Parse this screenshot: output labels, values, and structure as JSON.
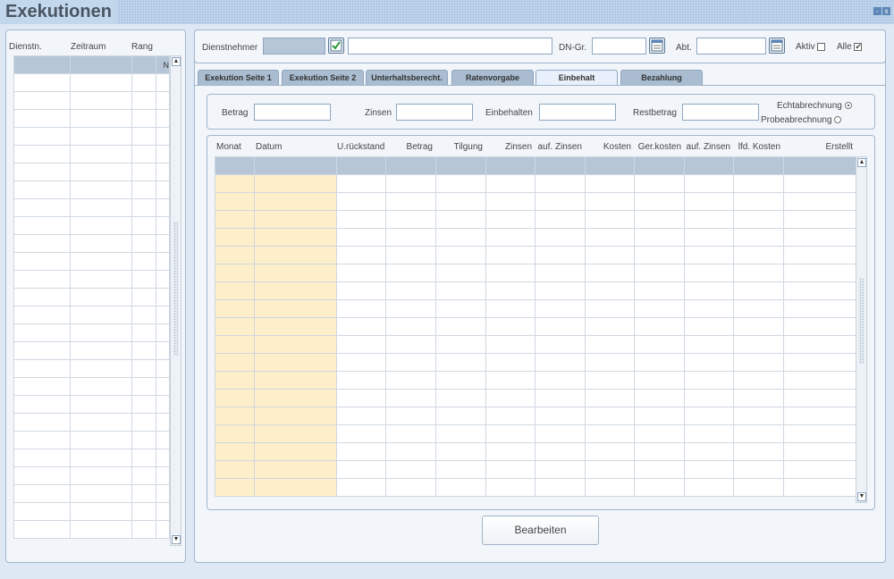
{
  "window": {
    "title": "Exekutionen",
    "minimize": "-",
    "close": "x"
  },
  "left_list": {
    "columns": [
      "Dienstn.",
      "Zeitraum",
      "Rang"
    ],
    "header_cell": "N",
    "rows": 27
  },
  "filter": {
    "dienstnehmer_label": "Dienstnehmer",
    "dienstnehmer_code": "",
    "dienstnehmer_name": "",
    "dn_gr_label": "DN-Gr.",
    "dn_gr_value": "",
    "abt_label": "Abt.",
    "abt_value": "",
    "aktiv_label": "Aktiv",
    "aktiv_checked": false,
    "alle_label": "Alle",
    "alle_checked": true
  },
  "tabs": [
    {
      "label": "Exekution Seite 1",
      "active": false
    },
    {
      "label": "Exekution Seite 2",
      "active": false
    },
    {
      "label": "Unterhaltsberecht.",
      "active": false
    },
    {
      "label": "Ratenvorgabe",
      "active": false
    },
    {
      "label": "Einbehalt",
      "active": true
    },
    {
      "label": "Bezahlung",
      "active": false
    }
  ],
  "summary": {
    "betrag_label": "Betrag",
    "betrag_value": "",
    "zinsen_label": "Zinsen",
    "zinsen_value": "",
    "einbehalten_label": "Einbehalten",
    "einbehalten_value": "",
    "restbetrag_label": "Restbetrag",
    "restbetrag_value": "",
    "echt_label": "Echtabrechnung",
    "probe_label": "Probeabrechnung",
    "selected_mode": "Echtabrechnung"
  },
  "einbehalt_table": {
    "columns": [
      "Monat",
      "Datum",
      "U.rückstand",
      "Betrag",
      "Tilgung",
      "Zinsen",
      "auf. Zinsen",
      "Kosten",
      "Ger.kosten",
      "auf. Zinsen",
      "lfd. Kosten",
      "Erstellt"
    ],
    "rows": 19
  },
  "actions": {
    "bearbeiten_label": "Bearbeiten"
  },
  "colors": {
    "accent": "#5d86b8",
    "highlight_column": "#fdefc9",
    "header_row": "#b6c6d6"
  }
}
